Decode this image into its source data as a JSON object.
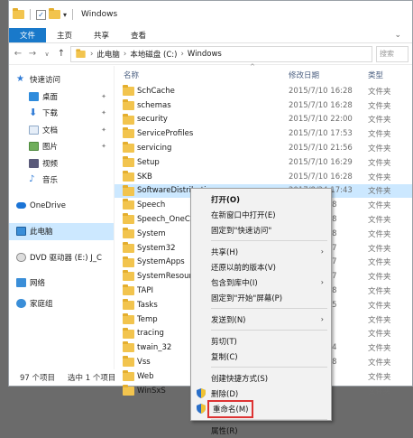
{
  "window": {
    "title": "Windows",
    "tabs": [
      "文件",
      "主页",
      "共享",
      "查看"
    ]
  },
  "address": {
    "crumbs": [
      "此电脑",
      "本地磁盘 (C:)",
      "Windows"
    ],
    "search_placeholder": "搜索"
  },
  "nav": {
    "quick_access": "快速访问",
    "desktop": "桌面",
    "downloads": "下载",
    "documents": "文档",
    "pictures": "图片",
    "videos": "视频",
    "music": "音乐",
    "onedrive": "OneDrive",
    "this_pc": "此电脑",
    "dvd": "DVD 驱动器 (E:) J_C",
    "network": "网络",
    "homegroup": "家庭组"
  },
  "columns": {
    "name": "名称",
    "date": "修改日期",
    "type": "类型"
  },
  "files": [
    {
      "name": "SchCache",
      "date": "2015/7/10 16:28",
      "type": "文件夹"
    },
    {
      "name": "schemas",
      "date": "2015/7/10 16:28",
      "type": "文件夹"
    },
    {
      "name": "security",
      "date": "2015/7/10 22:00",
      "type": "文件夹"
    },
    {
      "name": "ServiceProfiles",
      "date": "2015/7/10 17:53",
      "type": "文件夹"
    },
    {
      "name": "servicing",
      "date": "2015/7/10 21:56",
      "type": "文件夹"
    },
    {
      "name": "Setup",
      "date": "2015/7/10 16:29",
      "type": "文件夹"
    },
    {
      "name": "SKB",
      "date": "2015/7/10 16:28",
      "type": "文件夹"
    },
    {
      "name": "SoftwareDistribution",
      "date": "2017/8/24 17:43",
      "type": "文件夹"
    },
    {
      "name": "Speech",
      "date": "",
      "type": ""
    },
    {
      "name": "Speech_OneCo",
      "date": "",
      "type": ""
    },
    {
      "name": "System",
      "date": "",
      "type": ""
    },
    {
      "name": "System32",
      "date": "",
      "type": ""
    },
    {
      "name": "SystemApps",
      "date": "",
      "type": ""
    },
    {
      "name": "SystemResour",
      "date": "",
      "type": ""
    },
    {
      "name": "TAPI",
      "date": "",
      "type": ""
    },
    {
      "name": "Tasks",
      "date": "",
      "type": ""
    },
    {
      "name": "Temp",
      "date": "",
      "type": ""
    },
    {
      "name": "tracing",
      "date": "",
      "type": ""
    },
    {
      "name": "twain_32",
      "date": "",
      "type": ""
    },
    {
      "name": "Vss",
      "date": "",
      "type": ""
    },
    {
      "name": "Web",
      "date": "",
      "type": ""
    },
    {
      "name": "WinSxS",
      "date": "",
      "type": ""
    }
  ],
  "right_peek": [
    "",
    "",
    "",
    "",
    "",
    "",
    "",
    "",
    "16:28",
    "16:28",
    "16:28",
    "17:37",
    "14:37",
    "14:37",
    "16:28",
    "17:55",
    "",
    "",
    "17:34",
    "16:28",
    "",
    ""
  ],
  "status": {
    "count": "97 个项目",
    "selected": "选中 1 个项目"
  },
  "context_menu": {
    "open": "打开(O)",
    "open_new_window": "在新窗口中打开(E)",
    "pin_quick": "固定到\"快速访问\"",
    "share": "共享(H)",
    "restore": "还原以前的版本(V)",
    "include_library": "包含到库中(I)",
    "pin_start": "固定到\"开始\"屏幕(P)",
    "send_to": "发送到(N)",
    "cut": "剪切(T)",
    "copy": "复制(C)",
    "create_shortcut": "创建快捷方式(S)",
    "delete": "删除(D)",
    "rename": "重命名(M)",
    "properties": "属性(R)"
  },
  "colors": {
    "accent": "#1979ca",
    "selection": "#cce8ff",
    "highlight_box": "#dd3333"
  }
}
